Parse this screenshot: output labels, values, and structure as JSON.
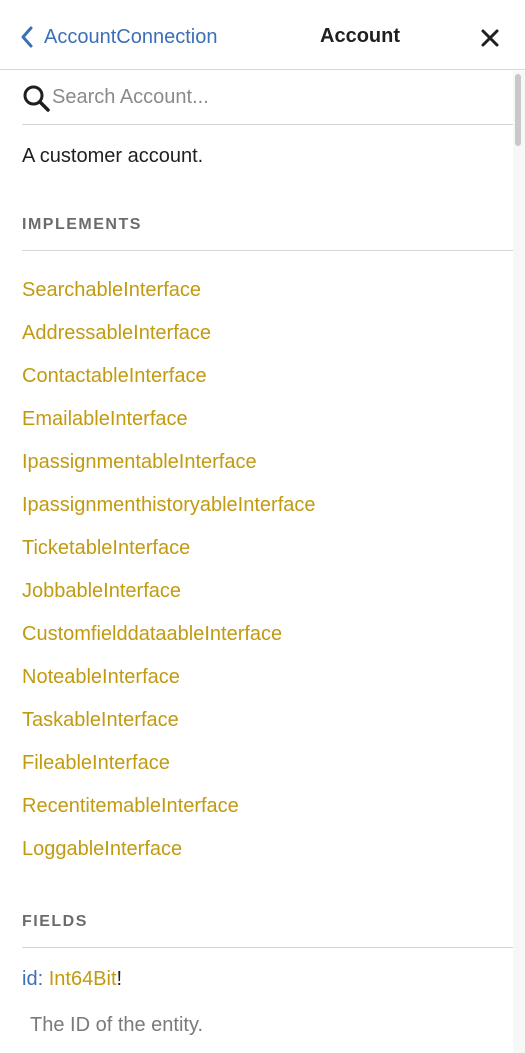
{
  "header": {
    "back_label": "AccountConnection",
    "title": "Account",
    "accent_color": "#3b6fb6",
    "close_icon": "close-icon",
    "back_icon": "chevron-left-icon"
  },
  "search": {
    "placeholder": "Search Account...",
    "value": ""
  },
  "description": "A customer account.",
  "implements": {
    "heading": "IMPLEMENTS",
    "link_color": "#c29a10",
    "items": [
      "SearchableInterface",
      "AddressableInterface",
      "ContactableInterface",
      "EmailableInterface",
      "IpassignmentableInterface",
      "IpassignmenthistoryableInterface",
      "TicketableInterface",
      "JobbableInterface",
      "CustomfielddataableInterface",
      "NoteableInterface",
      "TaskableInterface",
      "FileableInterface",
      "RecentitemableInterface",
      "LoggableInterface"
    ]
  },
  "fields": {
    "heading": "FIELDS",
    "items": [
      {
        "name": "id",
        "colon": ":",
        "type": "Int64Bit",
        "non_null": "!",
        "description": "The ID of the entity."
      }
    ]
  }
}
